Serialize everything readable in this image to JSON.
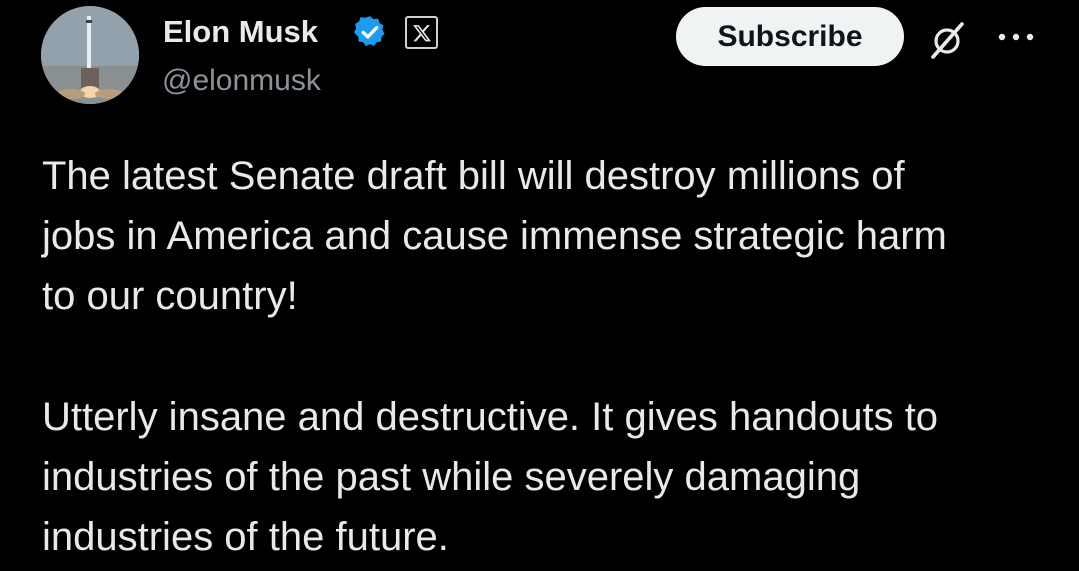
{
  "post": {
    "author": {
      "name": "Elon Musk",
      "handle": "@elonmusk",
      "verified": true,
      "badge_icon": "verified-check-icon",
      "affiliate_badge_icon": "x-logo-icon"
    },
    "actions": {
      "subscribe_label": "Subscribe",
      "grok_icon": "grok-icon",
      "more_icon": "more-options-icon"
    },
    "text": {
      "paragraph1": [
        "The latest Senate draft bill will destroy millions of",
        "jobs in America and cause immense strategic harm",
        "to our country!"
      ],
      "paragraph2": [
        "Utterly insane and destructive. It gives handouts to",
        "industries of the past while severely damaging",
        "industries of the future."
      ]
    }
  },
  "colors": {
    "background": "#000000",
    "primary_text": "#e7e9ea",
    "secondary_text": "#8b9299",
    "verified_blue": "#1d9bf0",
    "subscribe_bg": "#eff3f4"
  }
}
